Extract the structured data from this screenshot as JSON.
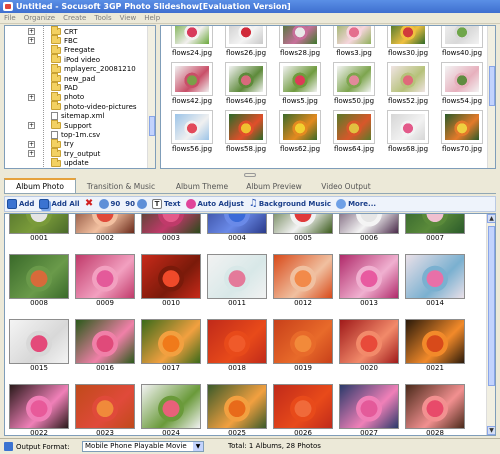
{
  "window": {
    "title": "Untitled - Socusoft 3GP Photo Slideshow[Evaluation Version]"
  },
  "menu": [
    "File",
    "Organize",
    "Create",
    "Tools",
    "View",
    "Help"
  ],
  "tree": {
    "items": [
      {
        "label": "CRT",
        "kind": "folder",
        "expander": "+"
      },
      {
        "label": "FBC",
        "kind": "folder",
        "expander": "+"
      },
      {
        "label": "Freegate",
        "kind": "folder",
        "expander": ""
      },
      {
        "label": "iPod video",
        "kind": "folder",
        "expander": ""
      },
      {
        "label": "mplayerc_20081210",
        "kind": "folder",
        "expander": ""
      },
      {
        "label": "new_pad",
        "kind": "folder",
        "expander": ""
      },
      {
        "label": "PAD",
        "kind": "folder",
        "expander": ""
      },
      {
        "label": "photo",
        "kind": "folder",
        "expander": "+"
      },
      {
        "label": "photo-video-pictures",
        "kind": "folder",
        "expander": ""
      },
      {
        "label": "sitemap.xml",
        "kind": "file",
        "expander": ""
      },
      {
        "label": "Support",
        "kind": "folder",
        "expander": "+"
      },
      {
        "label": "top-1m.csv",
        "kind": "file",
        "expander": ""
      },
      {
        "label": "try",
        "kind": "folder",
        "expander": "+"
      },
      {
        "label": "try_output",
        "kind": "folder",
        "expander": "+"
      },
      {
        "label": "update",
        "kind": "folder",
        "expander": ""
      }
    ]
  },
  "browser": {
    "files": [
      {
        "name": "flows24.jpg",
        "colors": [
          "#6aa83a",
          "#d83a5c",
          "#f3f0f0"
        ]
      },
      {
        "name": "flows26.jpg",
        "colors": [
          "#c9c9c9",
          "#d12b3a",
          "#f4f4f4"
        ]
      },
      {
        "name": "flows28.jpg",
        "colors": [
          "#3b7a2a",
          "#e9e9e9",
          "#c86f9a"
        ]
      },
      {
        "name": "flows3.jpg",
        "colors": [
          "#8fb05a",
          "#e46e8e",
          "#f7d6de"
        ]
      },
      {
        "name": "flows30.jpg",
        "colors": [
          "#2e6a2a",
          "#d13b3b",
          "#f0c040"
        ]
      },
      {
        "name": "flows40.jpg",
        "colors": [
          "#f2f2f2",
          "#6fa64a",
          "#d9d9d9"
        ]
      },
      {
        "name": "flows42.jpg",
        "colors": [
          "#f0f0f0",
          "#7a9f48",
          "#c94f68"
        ]
      },
      {
        "name": "flows46.jpg",
        "colors": [
          "#f3f3f3",
          "#d86a7c",
          "#5e8a3a"
        ]
      },
      {
        "name": "flows5.jpg",
        "colors": [
          "#f2f2f2",
          "#de3a57",
          "#6f9b3e"
        ]
      },
      {
        "name": "flows50.jpg",
        "colors": [
          "#f4f4f4",
          "#e28a9a",
          "#7da54e"
        ]
      },
      {
        "name": "flows52.jpg",
        "colors": [
          "#f0e4e4",
          "#e06a7a",
          "#b6c27a"
        ]
      },
      {
        "name": "flows54.jpg",
        "colors": [
          "#f3f3f3",
          "#5f8c40",
          "#e7b0bd"
        ]
      },
      {
        "name": "flows56.jpg",
        "colors": [
          "#9cc4e8",
          "#e24a5a",
          "#f0f0f0"
        ]
      },
      {
        "name": "flows58.jpg",
        "colors": [
          "#2a6a2a",
          "#f0c030",
          "#e04f2a"
        ]
      },
      {
        "name": "flows62.jpg",
        "colors": [
          "#3a6a2a",
          "#f2d030",
          "#e38a20"
        ]
      },
      {
        "name": "flows64.jpg",
        "colors": [
          "#5a7a2a",
          "#e2c040",
          "#d8572a"
        ]
      },
      {
        "name": "flows68.jpg",
        "colors": [
          "#d6d6d6",
          "#e35a8a",
          "#f2f2f2"
        ]
      },
      {
        "name": "flows70.jpg",
        "colors": [
          "#2a5a2a",
          "#f0d040",
          "#e47a2a"
        ]
      }
    ]
  },
  "tabs": [
    "Album Photo",
    "Transition & Music",
    "Album Theme",
    "Album Preview",
    "Video Output"
  ],
  "toolbar": {
    "add": "Add",
    "add_all": "Add All",
    "rotate_left": "90",
    "rotate_right": "90",
    "text": "Text",
    "auto_adjust": "Auto Adjust",
    "background_music": "Background Music",
    "more": "More..."
  },
  "album": {
    "items": [
      {
        "n": "0001",
        "colors": [
          "#4a6a2a",
          "#e4e4e4",
          "#7a9b3a"
        ]
      },
      {
        "n": "0002",
        "colors": [
          "#6a2a1a",
          "#e04a3a",
          "#f2c0a0"
        ]
      },
      {
        "n": "0003",
        "colors": [
          "#2a4a1a",
          "#e45a8a",
          "#c03a6a"
        ]
      },
      {
        "n": "0004",
        "colors": [
          "#2a3a8a",
          "#3a6ad8",
          "#6a8ae8"
        ]
      },
      {
        "n": "0005",
        "colors": [
          "#3a5a1a",
          "#e03a3a",
          "#f2f2f2"
        ]
      },
      {
        "n": "0006",
        "colors": [
          "#4a2a4a",
          "#e6e6e6",
          "#f4f4f4"
        ]
      },
      {
        "n": "0007",
        "colors": [
          "#2a5a2a",
          "#f0c0d0",
          "#5a8a3a"
        ]
      },
      {
        "n": "0008",
        "colors": [
          "#3a6a2a",
          "#d86a3a",
          "#6a9a4a"
        ]
      },
      {
        "n": "0009",
        "colors": [
          "#c03a6a",
          "#e45a9a",
          "#f2a0c0"
        ]
      },
      {
        "n": "0010",
        "colors": [
          "#c82a1a",
          "#f04a2a",
          "#7a1a0a"
        ]
      },
      {
        "n": "0011",
        "colors": [
          "#f2f2f2",
          "#e47a9a",
          "#d8e8e8"
        ]
      },
      {
        "n": "0012",
        "colors": [
          "#d84a1a",
          "#f28a4a",
          "#f0c0a0"
        ]
      },
      {
        "n": "0013",
        "colors": [
          "#b02a6a",
          "#e85aa0",
          "#f0b0d0"
        ]
      },
      {
        "n": "0014",
        "colors": [
          "#eae0e8",
          "#e870a8",
          "#7ab0d0"
        ]
      },
      {
        "n": "0015",
        "colors": [
          "#f4f4f4",
          "#e44a7a",
          "#d8d8d8"
        ]
      },
      {
        "n": "0016",
        "colors": [
          "#2a5a1a",
          "#e04a7a",
          "#f080a8"
        ]
      },
      {
        "n": "0017",
        "colors": [
          "#3a6a1a",
          "#f07a1a",
          "#f2a040"
        ]
      },
      {
        "n": "0018",
        "colors": [
          "#c02a1a",
          "#f05a2a",
          "#e84a1a"
        ]
      },
      {
        "n": "0019",
        "colors": [
          "#c8401a",
          "#f28a3a",
          "#e86a2a"
        ]
      },
      {
        "n": "0020",
        "colors": [
          "#a01a1a",
          "#e84a3a",
          "#f28a6a"
        ]
      },
      {
        "n": "0021",
        "colors": [
          "#2a1a0a",
          "#d84a1a",
          "#f28a2a"
        ]
      },
      {
        "n": "0022",
        "colors": [
          "#2a1a1a",
          "#e85a9a",
          "#f080b8"
        ]
      },
      {
        "n": "0023",
        "colors": [
          "#c04a1a",
          "#f08a3a",
          "#e04a3a"
        ]
      },
      {
        "n": "0024",
        "colors": [
          "#f2f2f2",
          "#e8607a",
          "#6a9a3a"
        ]
      },
      {
        "n": "0025",
        "colors": [
          "#3a5a2a",
          "#e86a1a",
          "#f2a040"
        ]
      },
      {
        "n": "0026",
        "colors": [
          "#c02a1a",
          "#f06a3a",
          "#e84a1a"
        ]
      },
      {
        "n": "0027",
        "colors": [
          "#2a3a6a",
          "#e45a9a",
          "#f080b8"
        ]
      },
      {
        "n": "0028",
        "colors": [
          "#4a2a1a",
          "#e84a6a",
          "#f29090"
        ]
      }
    ]
  },
  "status": {
    "label": "Output Format:",
    "format": "Mobile Phone Playable Movie",
    "total": "Total: 1 Albums, 28 Photos"
  }
}
